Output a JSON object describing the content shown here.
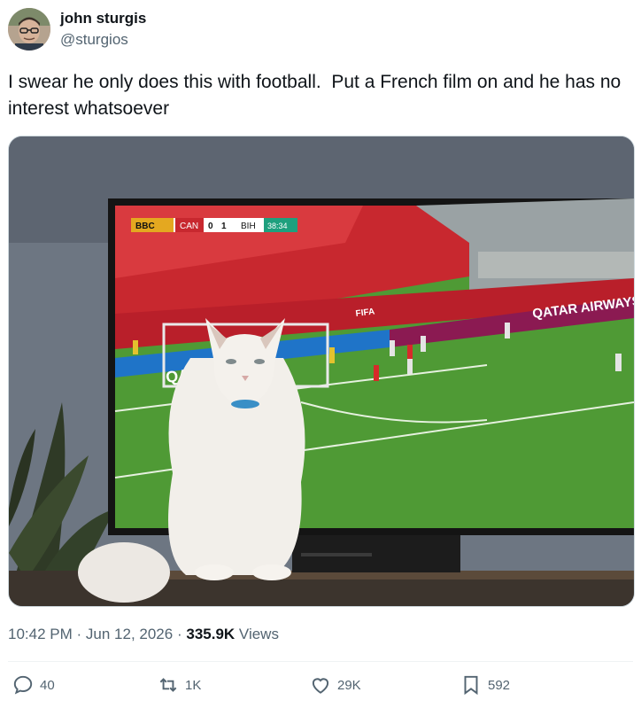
{
  "author": {
    "display_name": "john sturgis",
    "handle": "@sturgios",
    "avatar_icon": "user-avatar"
  },
  "tweet": {
    "text": "I swear he only does this with football.  Put a French film on and he has no interest whatsoever"
  },
  "media": {
    "scoreboard": {
      "broadcaster": "BBC",
      "team_home": "CAN",
      "score_home": "0",
      "score_away": "1",
      "team_away": "BIH",
      "clock": "38:34"
    },
    "ad_board_right": "QATAR AIRWAYS",
    "ad_board_left": "QAT",
    "ad_board_fifa": "FIFA"
  },
  "meta": {
    "time": "10:42 PM",
    "separator": "·",
    "date": "Jun 12, 2026",
    "views_count": "335.9K",
    "views_label": "Views"
  },
  "actions": {
    "replies": "40",
    "reposts": "1K",
    "likes": "29K",
    "bookmarks": "592"
  },
  "colors": {
    "text_primary": "#0f1419",
    "text_secondary": "#536471",
    "pitch_green": "#4f9a35",
    "crowd_red": "#c8282f"
  }
}
